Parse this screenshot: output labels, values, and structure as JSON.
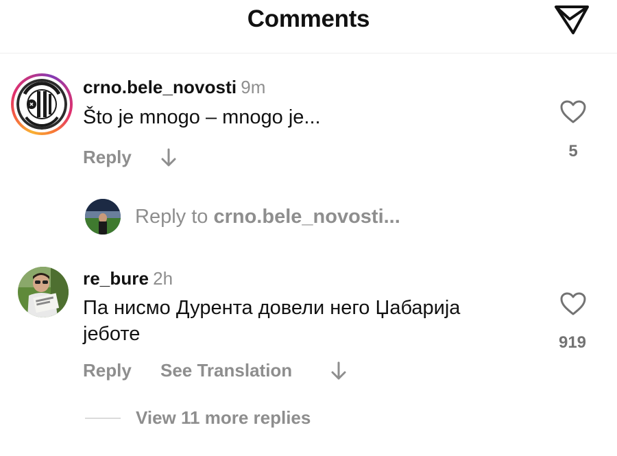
{
  "header": {
    "title": "Comments",
    "send_icon": "paper-plane-icon"
  },
  "comments": [
    {
      "username": "crno.bele_novosti",
      "time": "9m",
      "text": "Što je mnogo – mnogo je...",
      "reply_label": "Reply",
      "likes": "5",
      "has_story_ring": true
    },
    {
      "username": "re_bure",
      "time": "2h",
      "text_line1": "Па нисмо Дурента довели него Џабарија",
      "text_line2": "јеботе",
      "reply_label": "Reply",
      "translate_label": "See Translation",
      "likes": "919"
    }
  ],
  "reply_input": {
    "prefix": "Reply to ",
    "target": "crno.bele_novosti..."
  },
  "view_more": "View 11 more replies",
  "colors": {
    "text": "#111111",
    "muted": "#8e8e8e",
    "divider": "#ededed"
  }
}
